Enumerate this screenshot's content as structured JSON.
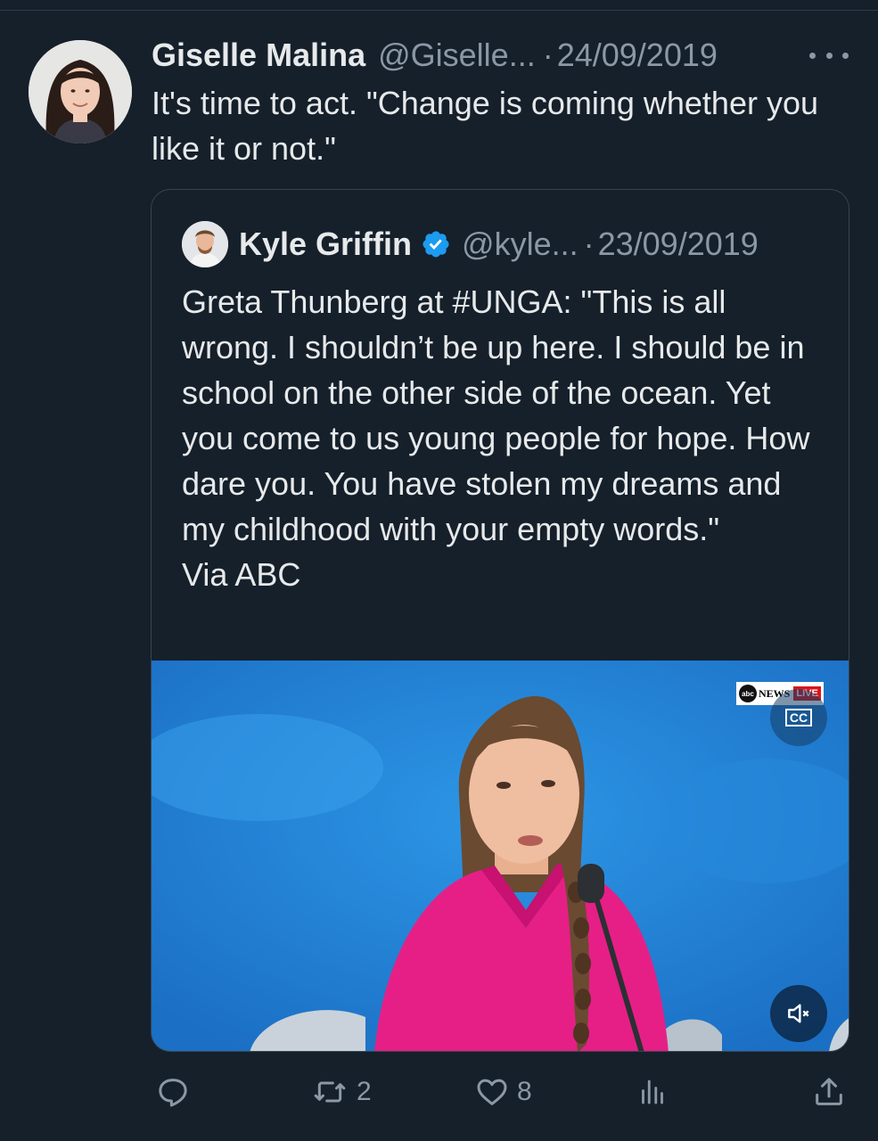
{
  "tweet": {
    "author_name": "Giselle Malina",
    "handle": "@Giselle...",
    "separator": "·",
    "date": "24/09/2019",
    "text": "It's time to act. \"Change is coming whether you like it or not.\""
  },
  "quoted_tweet": {
    "author_name": "Kyle Griffin",
    "handle": "@kyle...",
    "separator": "·",
    "date": "23/09/2019",
    "text": "Greta Thunberg at #UNGA: \"This is all wrong. I shouldn’t be up here. I should be in school on the other side of the ocean. Yet you come to us young people for hope. How dare you. You have stolen my dreams and my childhood with your empty words.\"",
    "via": "Via ABC",
    "media": {
      "logo_text": "NEWS",
      "logo_badge": "abc",
      "live_label": "LIVE",
      "cc_label": "CC"
    }
  },
  "actions": {
    "reply_count": "",
    "retweet_count": "2",
    "like_count": "8"
  },
  "colors": {
    "background": "#15202b",
    "text_primary": "#e7e9ea",
    "text_secondary": "#8b98a5",
    "verified": "#1d9bf0",
    "border": "#38444d"
  },
  "icons": [
    "more-icon",
    "verified-badge-icon",
    "closed-captions-icon",
    "mute-icon",
    "reply-icon",
    "retweet-icon",
    "like-icon",
    "views-icon",
    "share-icon"
  ]
}
